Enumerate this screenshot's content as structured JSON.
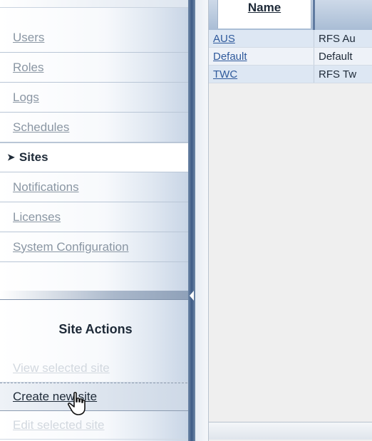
{
  "nav": {
    "items": [
      {
        "label": "Users"
      },
      {
        "label": "Roles"
      },
      {
        "label": "Logs"
      },
      {
        "label": "Schedules"
      },
      {
        "label": "Sites",
        "selected": true
      },
      {
        "label": "Notifications"
      },
      {
        "label": "Licenses"
      },
      {
        "label": "System Configuration"
      }
    ]
  },
  "actions": {
    "title": "Site Actions",
    "items": [
      {
        "label": "View selected site",
        "enabled": false
      },
      {
        "label": "Create new site",
        "enabled": true
      },
      {
        "label": "Edit selected site",
        "enabled": false
      }
    ]
  },
  "table": {
    "header": "Name",
    "rows": [
      {
        "name": "AUS",
        "desc": "RFS Au"
      },
      {
        "name": "Default",
        "desc": "Default"
      },
      {
        "name": "TWC",
        "desc": "RFS Tw"
      }
    ]
  },
  "icons": {
    "selected_marker": "arrow-right-icon",
    "cursor": "hand-pointer-icon",
    "splitter_grip": "collapse-left-icon"
  },
  "colors": {
    "splitter": "#3d5a84",
    "link": "#2f5a9c",
    "selected_bg": "#ffffff"
  }
}
